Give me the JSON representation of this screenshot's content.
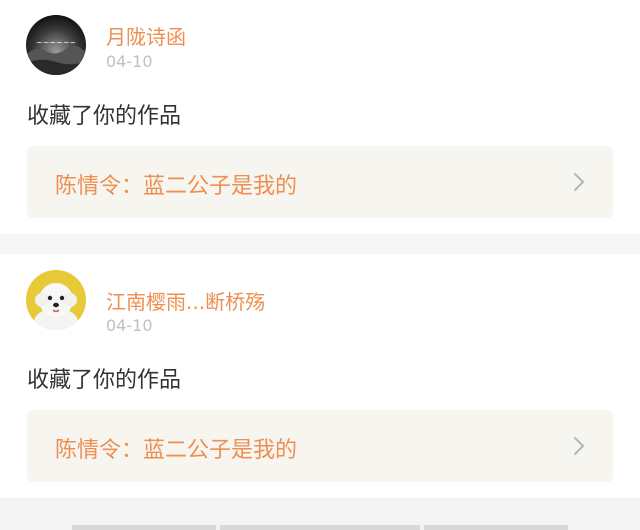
{
  "notifications": [
    {
      "username": "月陇诗函",
      "date": "04-10",
      "action": "收藏了你的作品",
      "work_title": "陈情令：蓝二公子是我的",
      "avatar_icon": "ink-landscape-avatar"
    },
    {
      "username": "江南樱雨...断桥殇",
      "date": "04-10",
      "action": "收藏了你的作品",
      "work_title": "陈情令：蓝二公子是我的",
      "avatar_icon": "white-dog-avatar"
    }
  ],
  "colors": {
    "accent": "#ee8f52",
    "date_gray": "#c0c0c0",
    "work_bg": "#f6f5ef",
    "separator": "#f6f6f6"
  }
}
